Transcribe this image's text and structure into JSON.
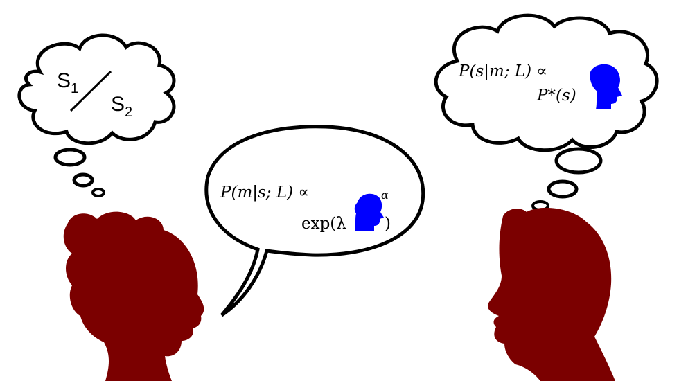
{
  "speaker_thought": {
    "s1": "S",
    "s1_sub": "1",
    "s2": "S",
    "s2_sub": "2"
  },
  "speaker_utterance": {
    "line1": "P(m|s; L) ∝",
    "line2": "exp(λ",
    "exponent": "α",
    "close_paren": ")"
  },
  "listener_thought": {
    "line1": "P(s|m; L) ∝",
    "line2": "P*(s)"
  },
  "colors": {
    "person": "#7b0000",
    "listener_icon": "#0000ff",
    "outline": "#000000"
  },
  "icons": [
    "speaker-head-silhouette",
    "listener-head-silhouette",
    "listener-icon"
  ]
}
